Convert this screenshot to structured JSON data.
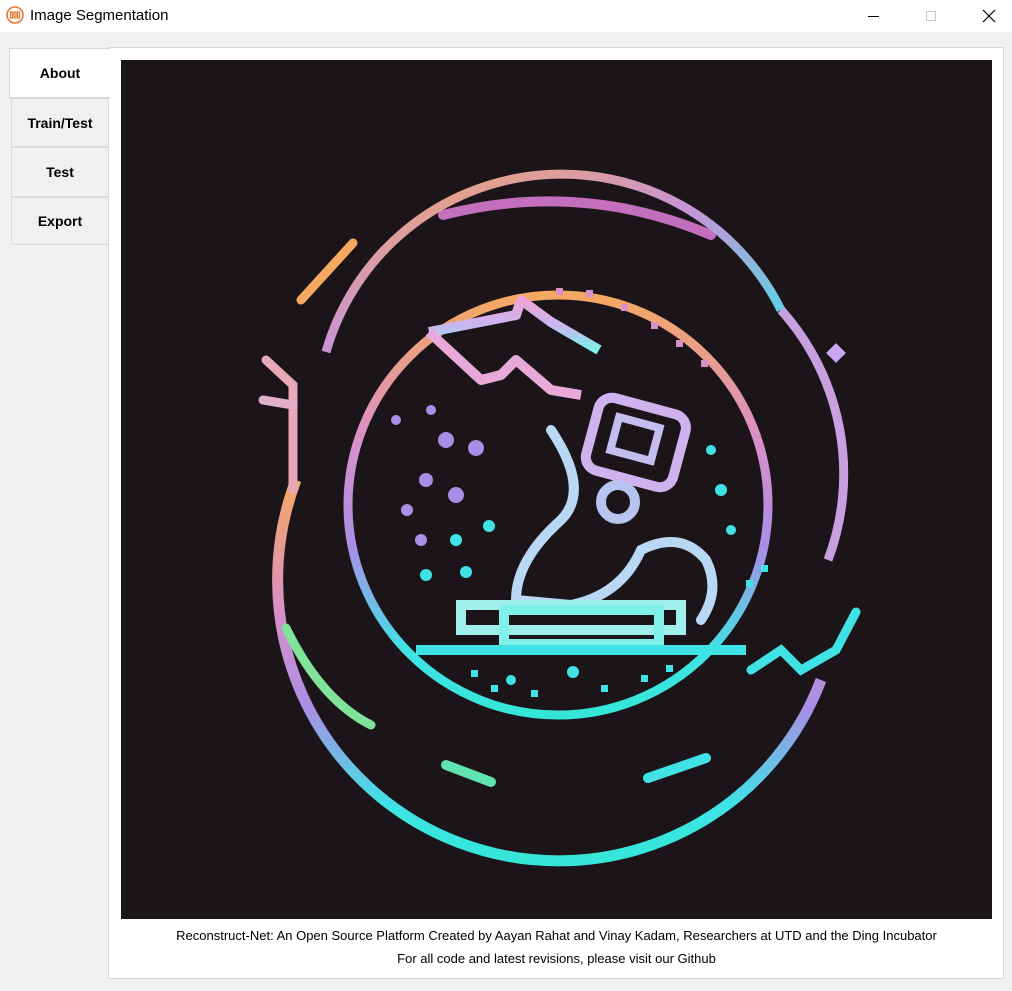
{
  "window": {
    "title": "Image Segmentation",
    "app_icon": "utd-logo-icon",
    "controls": [
      "minimize-icon",
      "maximize-icon",
      "close-icon"
    ]
  },
  "tabs": [
    {
      "label": "About",
      "active": true
    },
    {
      "label": "Train/Test",
      "active": false
    },
    {
      "label": "Test",
      "active": false
    },
    {
      "label": "Export",
      "active": false
    }
  ],
  "about": {
    "image": "microscope-logo-illustration",
    "caption_line1": "Reconstruct-Net: An Open Source Platform Created by Aayan Rahat and Vinay Kadam, Researchers at UTD and the Ding Incubator",
    "caption_line2": "For all code and latest revisions, please visit our Github"
  },
  "colors": {
    "image_background": "#1b1519",
    "ring_orange": "#f4a860",
    "ring_pink": "#d98fc9",
    "ring_purple": "#a98ee6",
    "ring_cyan": "#3fe3e6",
    "ring_green": "#7fe39a"
  }
}
